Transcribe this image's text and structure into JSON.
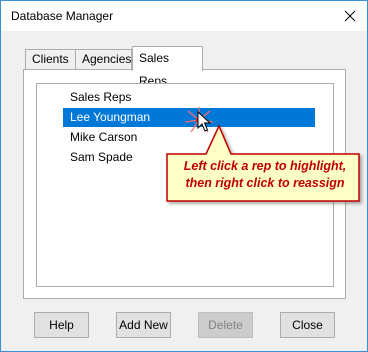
{
  "window": {
    "title": "Database Manager",
    "close_icon": "close-icon"
  },
  "tabs": [
    {
      "label": "Clients",
      "active": false
    },
    {
      "label": "Agencies",
      "active": false
    },
    {
      "label": "Sales Reps",
      "active": true
    }
  ],
  "list": {
    "header": "Sales Reps",
    "items": [
      {
        "label": "Lee Youngman",
        "selected": true
      },
      {
        "label": "Mike Carson",
        "selected": false
      },
      {
        "label": "Sam Spade",
        "selected": false
      }
    ]
  },
  "callout": {
    "line1": "Left click a rep to highlight,",
    "line2": "then right click to reassign",
    "text_color": "#c00000",
    "fill_color": "#ffffc8"
  },
  "buttons": {
    "help": "Help",
    "add_new": "Add New",
    "delete": "Delete",
    "close": "Close"
  },
  "colors": {
    "selection": "#0078d7",
    "window_border": "#3b8fd6"
  }
}
